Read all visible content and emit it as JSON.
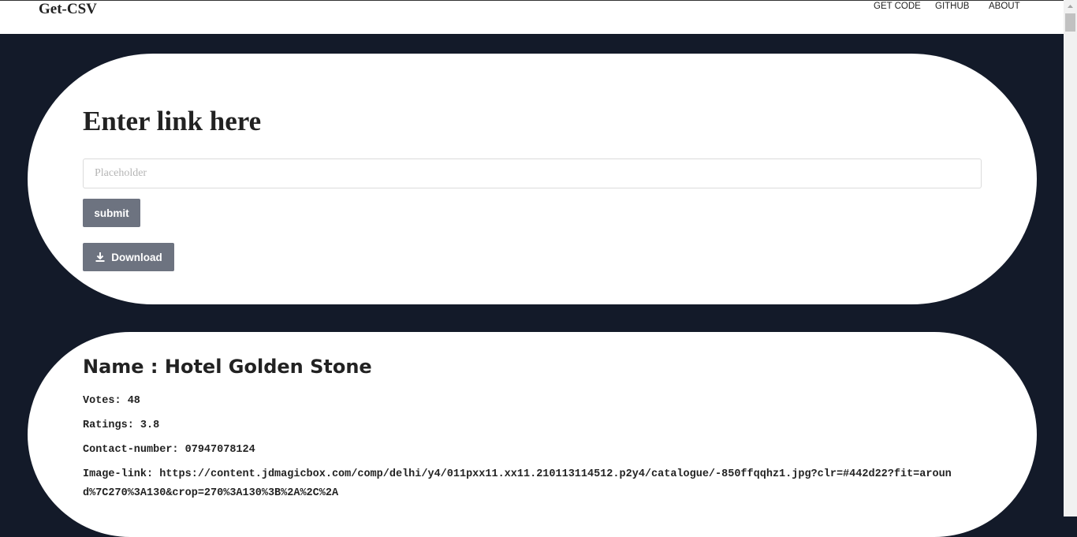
{
  "navbar": {
    "brand": "Get-CSV",
    "links": [
      "GET CODE",
      "GITHUB",
      "ABOUT"
    ]
  },
  "form": {
    "heading": "Enter link here",
    "input_placeholder": "Placeholder",
    "input_value": "",
    "submit_label": "submit",
    "download_label": "Download",
    "download_icon": "download-icon"
  },
  "result": {
    "name_line": "Name : Hotel Golden Stone",
    "votes_line": "Votes: 48",
    "ratings_line": "Ratings: 3.8",
    "contact_line": "Contact-number: 07947078124",
    "image_line": "Image-link: https://content.jdmagicbox.com/comp/delhi/y4/011pxx11.xx11.210113114512.p2y4/catalogue/-850ffqqhz1.jpg?clr=#442d22?fit=around%7C270%3A130&crop=270%3A130%3B%2A%2C%2A"
  },
  "colors": {
    "background": "#131a29",
    "button": "#6d7380",
    "card": "#ffffff"
  }
}
